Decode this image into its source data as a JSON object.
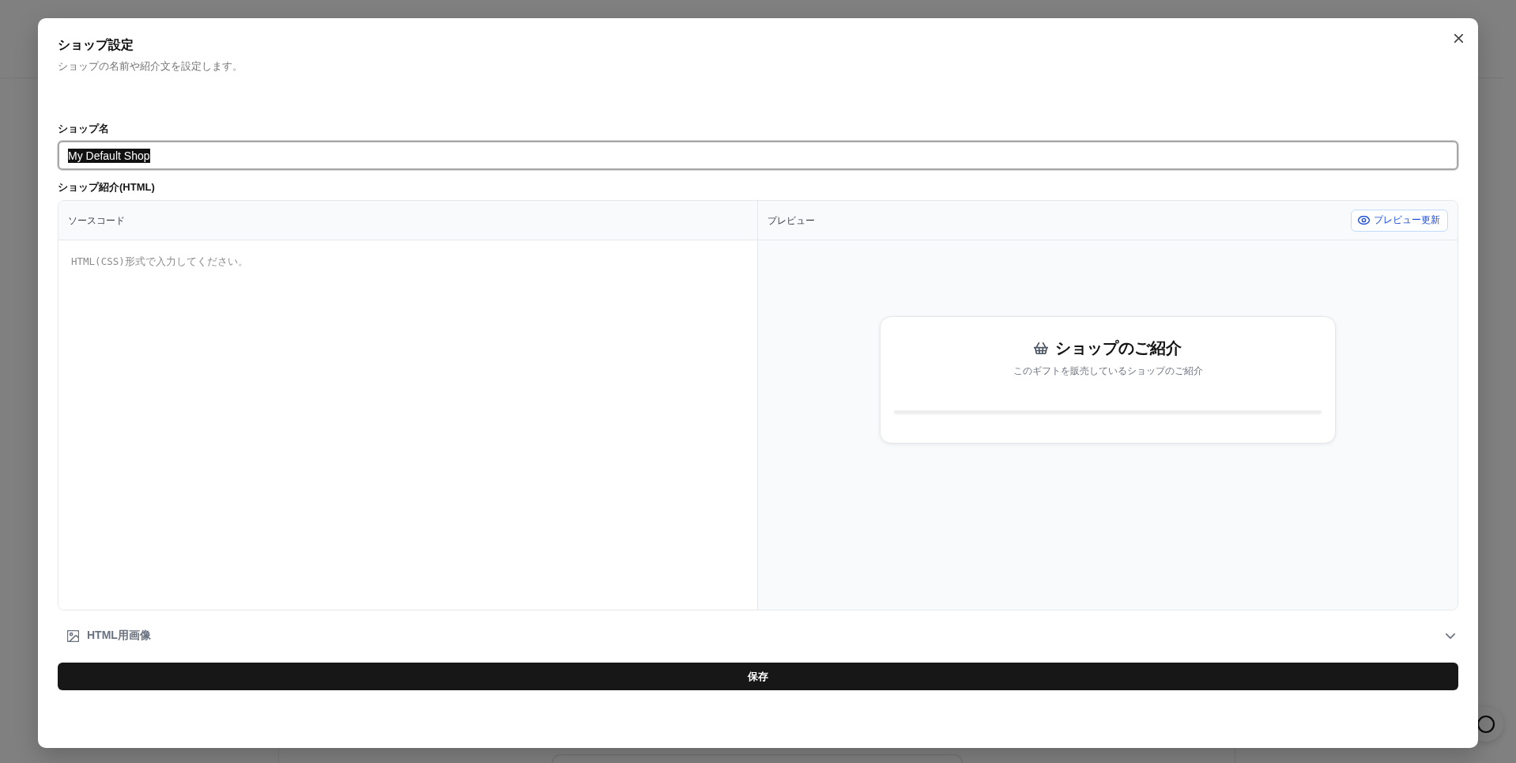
{
  "dialog": {
    "title": "ショップ設定",
    "description": "ショップの名前や紹介文を設定します。"
  },
  "shop_name": {
    "label": "ショップ名",
    "value": "My Default Shop",
    "focused": true,
    "text_selected": true
  },
  "introduction": {
    "label": "ショップ紹介(HTML)",
    "source": {
      "heading": "ソースコード",
      "placeholder": "HTML(CSS)形式で入力してください。"
    },
    "preview": {
      "heading": "プレビュー",
      "refresh_button": "プレビュー更新",
      "card": {
        "title": "ショップのご紹介",
        "subtitle": "このギフトを販売しているショップのご紹介"
      }
    }
  },
  "image_section": {
    "label": "HTML用画像",
    "expanded": false
  },
  "save_button": "保存"
}
